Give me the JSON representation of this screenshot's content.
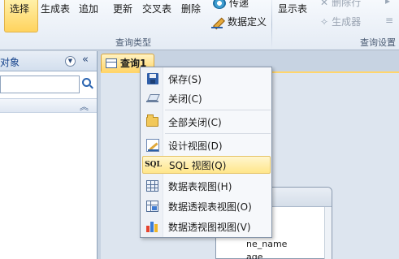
{
  "ribbon": {
    "buttons": {
      "select": "选择",
      "make_table": "生成表",
      "append": "追加",
      "update": "更新",
      "crosstab": "交叉表",
      "delete": "删除"
    },
    "small_items": {
      "passthrough": "传递",
      "data_definition": "数据定义",
      "show_table": "显示表",
      "delete_rows": "删除行",
      "builder": "生成器"
    },
    "groups": {
      "query_type": "查询类型",
      "query_setup": "查询设置"
    }
  },
  "nav_pane": {
    "title": "对象"
  },
  "document": {
    "tab_label": "查询1",
    "table_fields": [
      "ne_name",
      "age"
    ]
  },
  "context_menu": {
    "items": [
      {
        "label": "保存(S)",
        "icon": "save-icon"
      },
      {
        "label": "关闭(C)",
        "icon": "close-icon"
      },
      {
        "label": "全部关闭(C)",
        "icon": "close-all-icon"
      },
      {
        "label": "设计视图(D)",
        "icon": "design-view-icon"
      },
      {
        "label": "SQL 视图(Q)",
        "icon": "sql-view-icon",
        "icon_text": "SQL",
        "highlighted": true
      },
      {
        "label": "数据表视图(H)",
        "icon": "datasheet-view-icon"
      },
      {
        "label": "数据透视表视图(O)",
        "icon": "pivot-table-view-icon"
      },
      {
        "label": "数据透视图视图(V)",
        "icon": "pivot-chart-view-icon"
      }
    ]
  }
}
